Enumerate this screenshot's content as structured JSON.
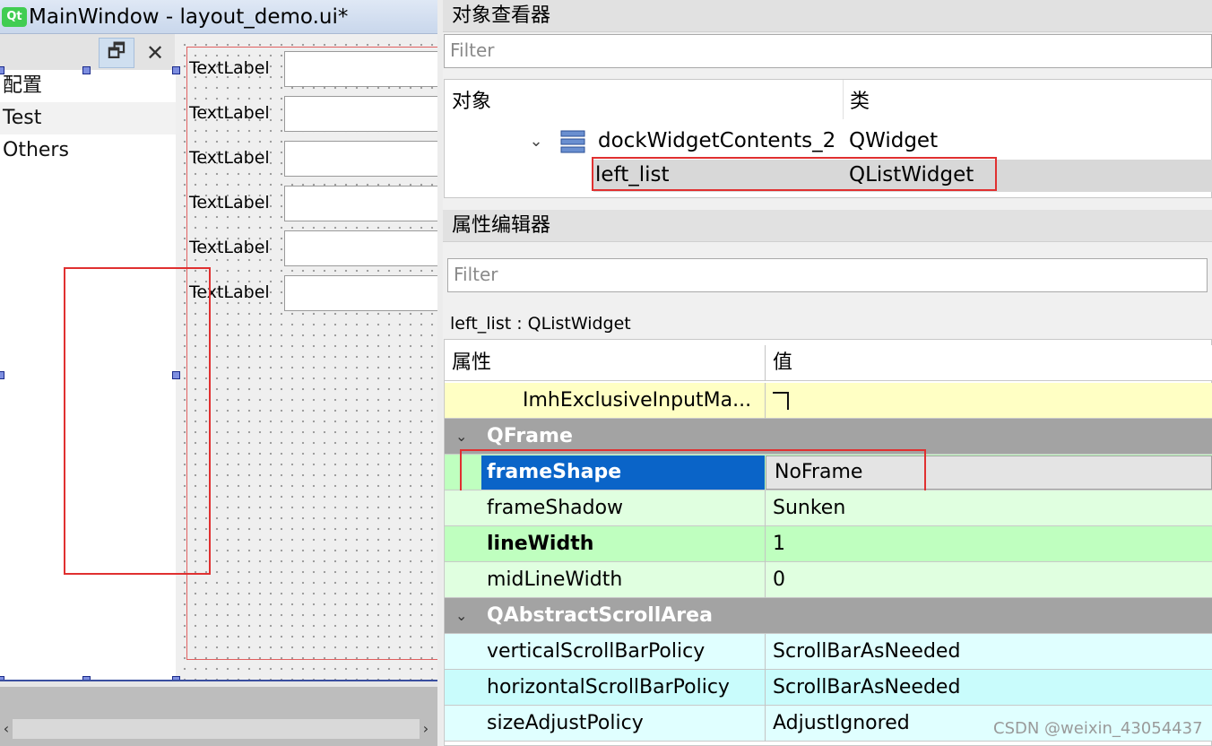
{
  "designer": {
    "window_title": "MainWindow - layout_demo.ui*",
    "qt_logo": "Qt",
    "dock": {
      "float_icon": "float-icon",
      "close_icon": "close-icon",
      "float_glyph": "🗗",
      "close_glyph": "✕"
    },
    "left_list": {
      "items": [
        "配置",
        "Test",
        "Others"
      ]
    },
    "form": {
      "labels": [
        "TextLabel",
        "TextLabel",
        "TextLabel",
        "TextLabel",
        "TextLabel",
        "TextLabel"
      ]
    },
    "scroll": {
      "left_glyph": "‹",
      "right_glyph": "›"
    }
  },
  "object_inspector": {
    "title": "对象查看器",
    "filter_placeholder": "Filter",
    "columns": {
      "object": "对象",
      "class": "类"
    },
    "rows": [
      {
        "name": "dockWidgetContents_2",
        "class": "QWidget",
        "icon": "layout-icon",
        "expanded": true
      },
      {
        "name": "left_list",
        "class": "QListWidget",
        "selected": true
      }
    ],
    "expand_glyph": "⌄"
  },
  "property_editor": {
    "title": "属性编辑器",
    "filter_placeholder": "Filter",
    "class_caption": "left_list : QListWidget",
    "columns": {
      "property": "属性",
      "value": "值"
    },
    "rows": [
      {
        "name": "ImhExclusiveInputMa...",
        "value": "",
        "kind": "checkbox"
      },
      {
        "name": "QFrame",
        "kind": "group"
      },
      {
        "name": "frameShape",
        "value": "NoFrame",
        "bold": true,
        "selected": true
      },
      {
        "name": "frameShadow",
        "value": "Sunken"
      },
      {
        "name": "lineWidth",
        "value": "1",
        "bold": true
      },
      {
        "name": "midLineWidth",
        "value": "0"
      },
      {
        "name": "QAbstractScrollArea",
        "kind": "group"
      },
      {
        "name": "verticalScrollBarPolicy",
        "value": "ScrollBarAsNeeded"
      },
      {
        "name": "horizontalScrollBarPolicy",
        "value": "ScrollBarAsNeeded"
      },
      {
        "name": "sizeAdjustPolicy",
        "value": "AdjustIgnored"
      }
    ],
    "group_glyph": "⌄"
  },
  "watermark": "CSDN @weixin_43054437",
  "colors": {
    "highlight_red": "#e03030",
    "selection_blue": "#0a64c8",
    "frame_green": "#bfffbf",
    "scroll_cyan": "#c9fcfc",
    "input_yellow": "#ffffc4",
    "group_gray": "#a3a3a3"
  }
}
